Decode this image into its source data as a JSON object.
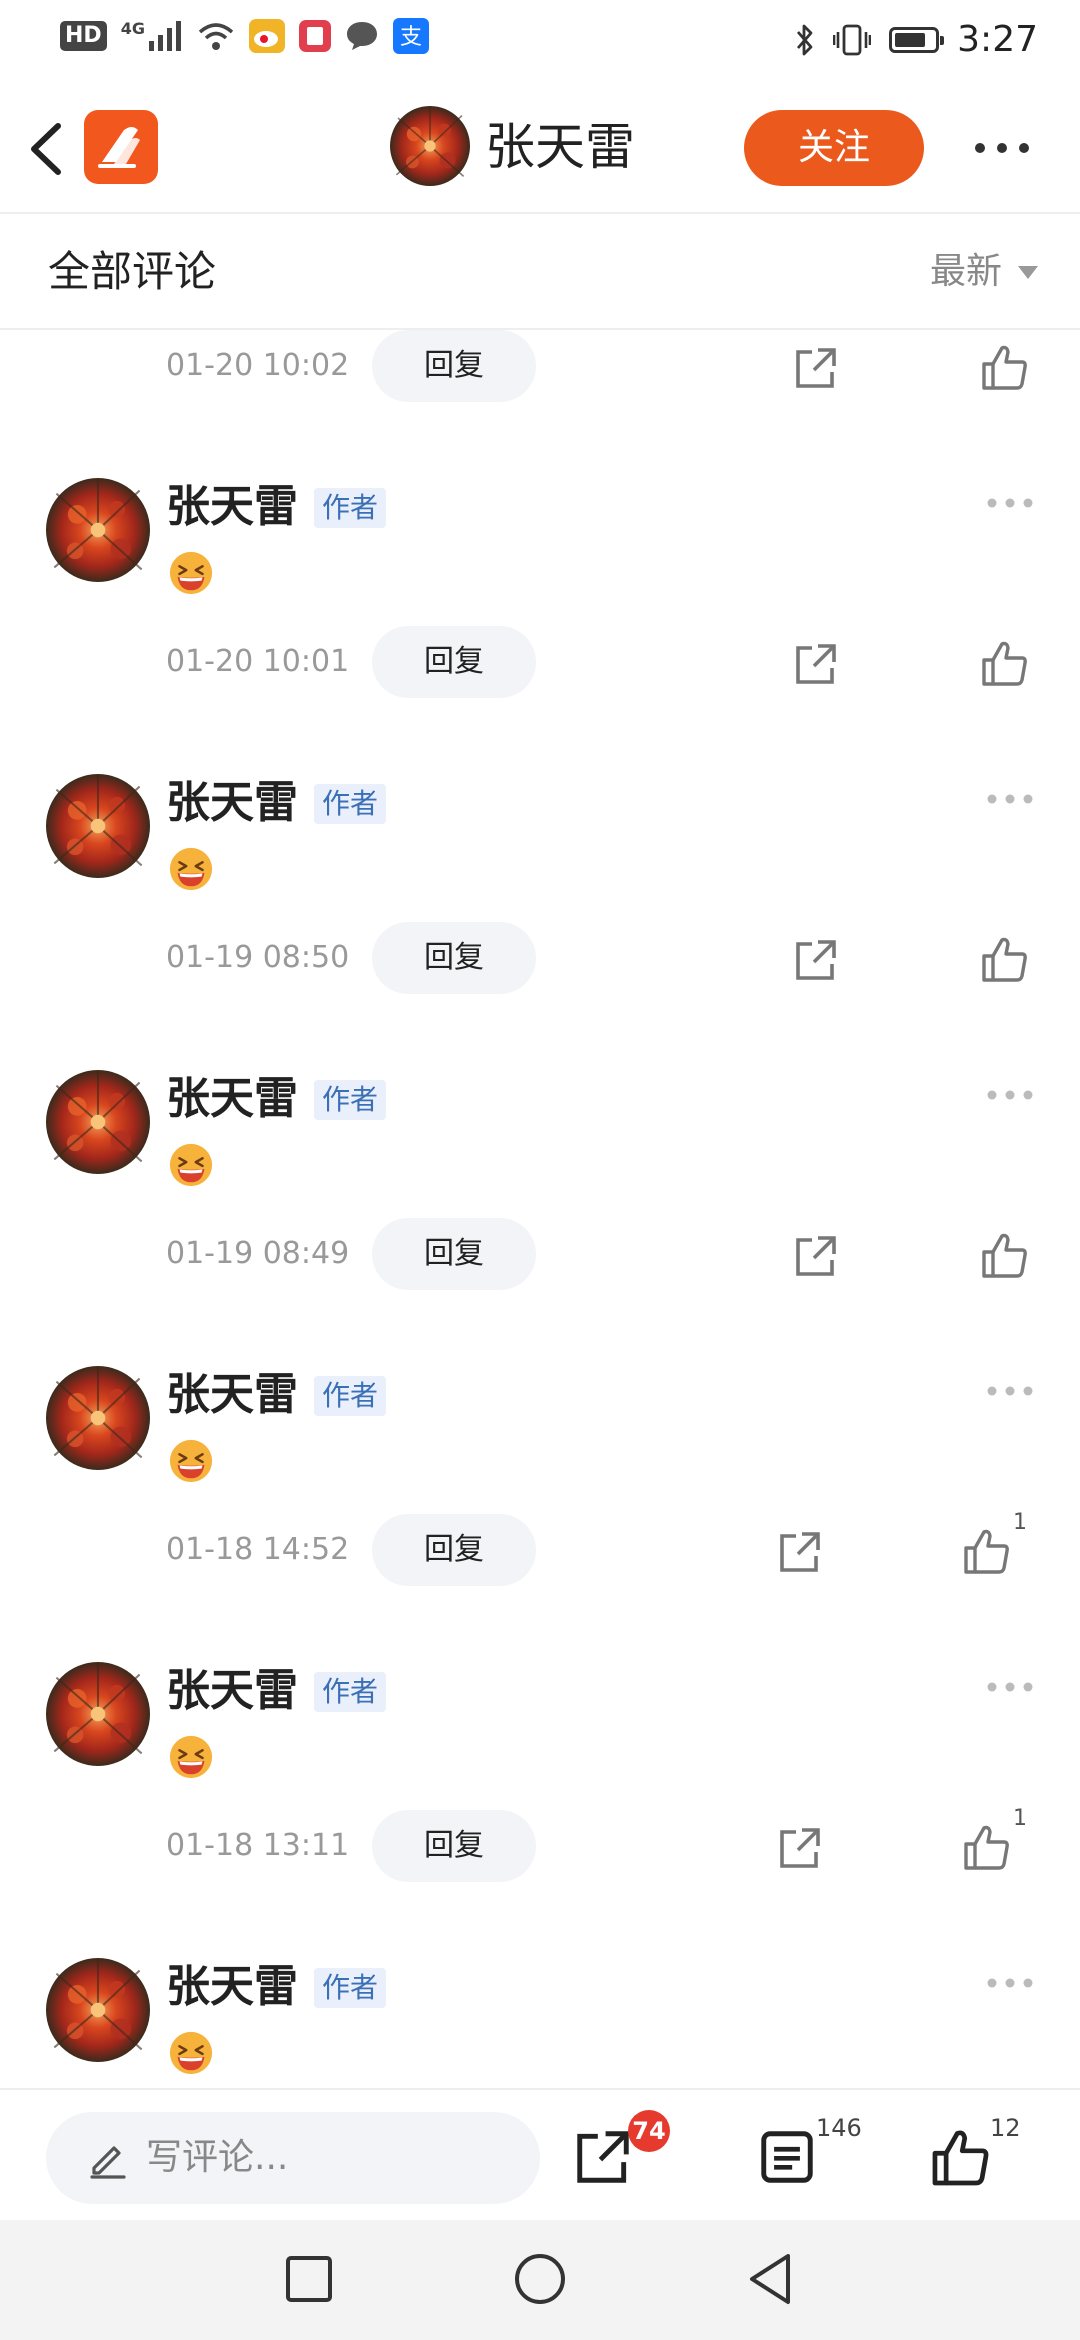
{
  "status_bar": {
    "hd": "HD",
    "network": "4G",
    "time": "3:27",
    "battery_level": 0.8
  },
  "header": {
    "author_name": "张天雷",
    "follow_label": "关注",
    "brand_color": "#eb5a1c"
  },
  "section": {
    "title": "全部评论",
    "sort_label": "最新"
  },
  "comments": [
    {
      "name": "张天雷",
      "badge": "作者",
      "emoji": "grinning-squint-emoji",
      "time": "01-20 10:02",
      "reply_label": "回复",
      "likes": ""
    },
    {
      "name": "张天雷",
      "badge": "作者",
      "emoji": "grinning-squint-emoji",
      "time": "01-20 10:01",
      "reply_label": "回复",
      "likes": ""
    },
    {
      "name": "张天雷",
      "badge": "作者",
      "emoji": "grinning-squint-emoji",
      "time": "01-19 08:50",
      "reply_label": "回复",
      "likes": ""
    },
    {
      "name": "张天雷",
      "badge": "作者",
      "emoji": "grinning-squint-emoji",
      "time": "01-19 08:49",
      "reply_label": "回复",
      "likes": ""
    },
    {
      "name": "张天雷",
      "badge": "作者",
      "emoji": "grinning-squint-emoji",
      "time": "01-18 14:52",
      "reply_label": "回复",
      "likes": "1"
    },
    {
      "name": "张天雷",
      "badge": "作者",
      "emoji": "grinning-squint-emoji",
      "time": "01-18 13:11",
      "reply_label": "回复",
      "likes": "1"
    },
    {
      "name": "张天雷",
      "badge": "作者",
      "emoji": "grinning-squint-emoji",
      "time": "",
      "reply_label": "",
      "likes": ""
    }
  ],
  "bottom_bar": {
    "placeholder": "写评论...",
    "share_badge": "74",
    "comment_count": "146",
    "like_count": "12"
  }
}
